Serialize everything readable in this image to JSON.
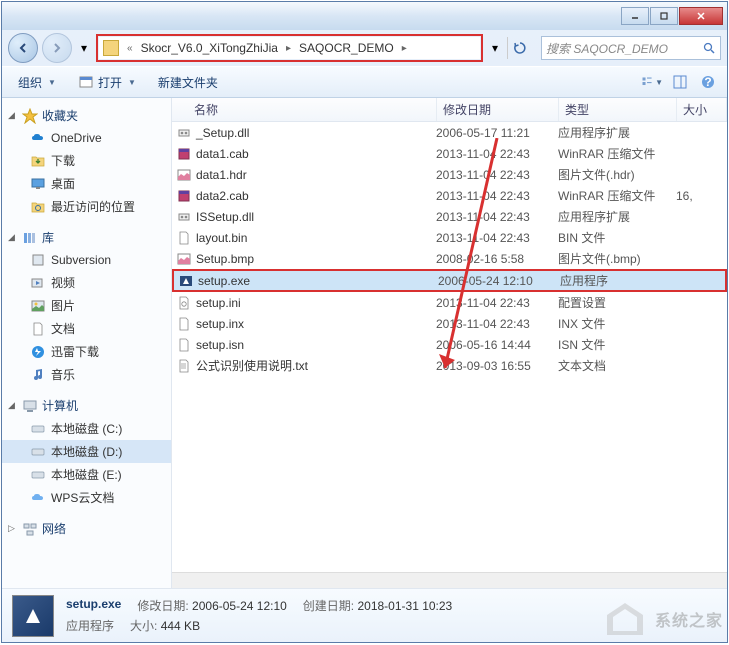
{
  "titlebar": {
    "min": "_",
    "max": "□",
    "close": "×"
  },
  "breadcrumb": {
    "seg1": "Skocr_V6.0_XiTongZhiJia",
    "seg2": "SAQOCR_DEMO"
  },
  "search": {
    "placeholder": "搜索 SAQOCR_DEMO"
  },
  "toolbar": {
    "organize": "组织",
    "open": "打开",
    "newfolder": "新建文件夹"
  },
  "columns": {
    "name": "名称",
    "date": "修改日期",
    "type": "类型",
    "size": "大小"
  },
  "sidebar": {
    "favorites": {
      "label": "收藏夹"
    },
    "fav_items": [
      {
        "label": "OneDrive"
      },
      {
        "label": "下载"
      },
      {
        "label": "桌面"
      },
      {
        "label": "最近访问的位置"
      }
    ],
    "libraries": {
      "label": "库"
    },
    "lib_items": [
      {
        "label": "Subversion"
      },
      {
        "label": "视频"
      },
      {
        "label": "图片"
      },
      {
        "label": "文档"
      },
      {
        "label": "迅雷下载"
      },
      {
        "label": "音乐"
      }
    ],
    "computer": {
      "label": "计算机"
    },
    "comp_items": [
      {
        "label": "本地磁盘 (C:)"
      },
      {
        "label": "本地磁盘 (D:)"
      },
      {
        "label": "本地磁盘 (E:)"
      },
      {
        "label": "WPS云文档"
      }
    ],
    "network": {
      "label": "网络"
    }
  },
  "files": [
    {
      "name": "_Setup.dll",
      "date": "2006-05-17 11:21",
      "type": "应用程序扩展",
      "size": ""
    },
    {
      "name": "data1.cab",
      "date": "2013-11-04 22:43",
      "type": "WinRAR 压缩文件",
      "size": ""
    },
    {
      "name": "data1.hdr",
      "date": "2013-11-04 22:43",
      "type": "图片文件(.hdr)",
      "size": ""
    },
    {
      "name": "data2.cab",
      "date": "2013-11-04 22:43",
      "type": "WinRAR 压缩文件",
      "size": "16,"
    },
    {
      "name": "ISSetup.dll",
      "date": "2013-11-04 22:43",
      "type": "应用程序扩展",
      "size": ""
    },
    {
      "name": "layout.bin",
      "date": "2013-11-04 22:43",
      "type": "BIN 文件",
      "size": ""
    },
    {
      "name": "Setup.bmp",
      "date": "2008-02-16 5:58",
      "type": "图片文件(.bmp)",
      "size": ""
    },
    {
      "name": "setup.exe",
      "date": "2006-05-24 12:10",
      "type": "应用程序",
      "size": ""
    },
    {
      "name": "setup.ini",
      "date": "2013-11-04 22:43",
      "type": "配置设置",
      "size": ""
    },
    {
      "name": "setup.inx",
      "date": "2013-11-04 22:43",
      "type": "INX 文件",
      "size": ""
    },
    {
      "name": "setup.isn",
      "date": "2006-05-16 14:44",
      "type": "ISN 文件",
      "size": ""
    },
    {
      "name": "公式识别使用说明.txt",
      "date": "2013-09-03 16:55",
      "type": "文本文档",
      "size": ""
    }
  ],
  "details": {
    "filename": "setup.exe",
    "moddate_label": "修改日期:",
    "moddate": "2006-05-24 12:10",
    "created_label": "创建日期:",
    "created": "2018-01-31 10:23",
    "filetype": "应用程序",
    "size_label": "大小:",
    "size": "444 KB"
  },
  "watermark": {
    "text": "系统之家"
  }
}
